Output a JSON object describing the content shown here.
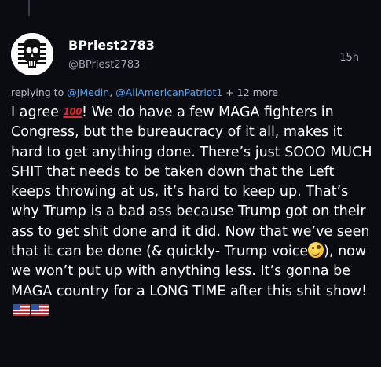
{
  "post": {
    "display_name": "BPriest2783",
    "handle": "@BPriest2783",
    "timestamp": "15h",
    "reply": {
      "prefix": "replying to",
      "mentions": [
        "@JMedin",
        "@AllAmericanPatriot1"
      ],
      "more": "+ 12 more"
    },
    "body": {
      "t1": "I agree ",
      "t2": "! We do have a few MAGA fighters in Congress, but the bureaucracy of it all, makes it hard to get anything done. There’s just SOOO MUCH SHIT that needs to be taken down that the Left keeps throwing at us, it’s hard to keep up. That’s why Trump is a bad ass because Trump got on their ass to get shit done and it did. Now that we’ve seen that it can be done (& quickly- Trump voice",
      "t3": "), now we won’t put up with anything less. It’s gonna be MAGA country for a LONG TIME after this shit show! ",
      "emojis": [
        "100-emoji",
        "zany-face-emoji",
        "us-flag-emoji",
        "us-flag-emoji"
      ]
    }
  },
  "colors": {
    "background": "#0b0c12",
    "mention": "#4aa8ff",
    "secondary_text": "#a3a7b3"
  }
}
